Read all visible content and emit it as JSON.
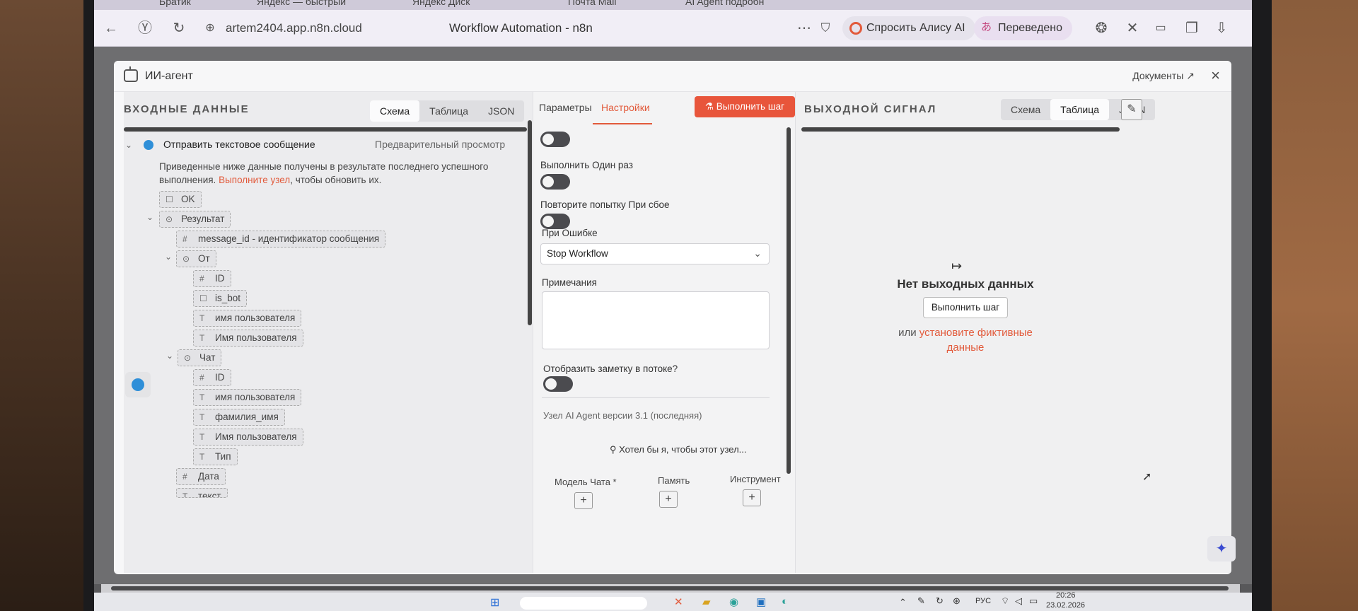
{
  "browser": {
    "tabs": [
      "Братик",
      "Яндекс — быстрый",
      "Яндекс Диск",
      "Почта Mail",
      "AI Agent подробн"
    ],
    "url": "artem2404.app.n8n.cloud",
    "page_title": "Workflow Automation - n8n",
    "alice_label": "Спросить Алису AI",
    "translated_label": "Переведено"
  },
  "modal": {
    "title": "ИИ-агент",
    "docs_label": "Документы",
    "close_label": "×"
  },
  "input_panel": {
    "heading": "ВХОДНЫЕ ДАННЫЕ",
    "views": [
      "Схема",
      "Таблица",
      "JSON"
    ],
    "active_view": "Схема",
    "node_name": "Отправить текстовое сообщение",
    "preview_label": "Предварительный просмотр",
    "note_prefix": "Приведенные ниже данные получены в результате последнего успешного выполнения.",
    "note_link": "Выполните узел",
    "note_suffix": ", чтобы обновить их.",
    "tree": [
      {
        "icon": "☐",
        "label": "OK"
      },
      {
        "icon": "⊙",
        "label": "Результат"
      },
      {
        "icon": "#",
        "label": "message_id - идентификатор сообщения"
      },
      {
        "icon": "⊙",
        "label": "От"
      },
      {
        "icon": "#",
        "label": "ID"
      },
      {
        "icon": "☐",
        "label": "is_bot"
      },
      {
        "icon": "T",
        "label": "имя пользователя"
      },
      {
        "icon": "T",
        "label": "Имя пользователя"
      },
      {
        "icon": "⊙",
        "label": "Чат"
      },
      {
        "icon": "#",
        "label": "ID"
      },
      {
        "icon": "T",
        "label": "имя пользователя"
      },
      {
        "icon": "T",
        "label": "фамилия_имя"
      },
      {
        "icon": "T",
        "label": "Имя пользователя"
      },
      {
        "icon": "T",
        "label": "Тип"
      },
      {
        "icon": "#",
        "label": "Дата"
      },
      {
        "icon": "T",
        "label": "текст"
      }
    ]
  },
  "settings_panel": {
    "tab_params": "Параметры",
    "tab_settings": "Настройки",
    "run_step_label": "Выполнить шаг",
    "execute_once_label": "Выполнить Один раз",
    "retry_label": "Повторите попытку При сбое",
    "on_error_label": "При Ошибке",
    "on_error_value": "Stop Workflow",
    "notes_label": "Примечания",
    "show_note_label": "Отобразить заметку в потоке?",
    "version_text": "Узел AI Agent версии 3.1 (последняя)",
    "wish_text": "Хотел бы я, чтобы этот узел...",
    "connectors": [
      "Модель Чата *",
      "Память",
      "Инструмент"
    ]
  },
  "output_panel": {
    "heading": "ВЫХОДНОЙ СИГНАЛ",
    "views": [
      "Схема",
      "Таблица",
      "JSON"
    ],
    "active_view": "Таблица",
    "empty_title": "Нет выходных данных",
    "run_step_label": "Выполнить шаг",
    "or_label": "или",
    "mock_link": "установите фиктивные данные"
  },
  "taskbar": {
    "lang": "РУС",
    "time": "20:26",
    "date": "23.02.2026"
  },
  "colors": {
    "accent": "#e25a3b",
    "run_button": "#e8553b",
    "telegram": "#2f8fd8"
  }
}
